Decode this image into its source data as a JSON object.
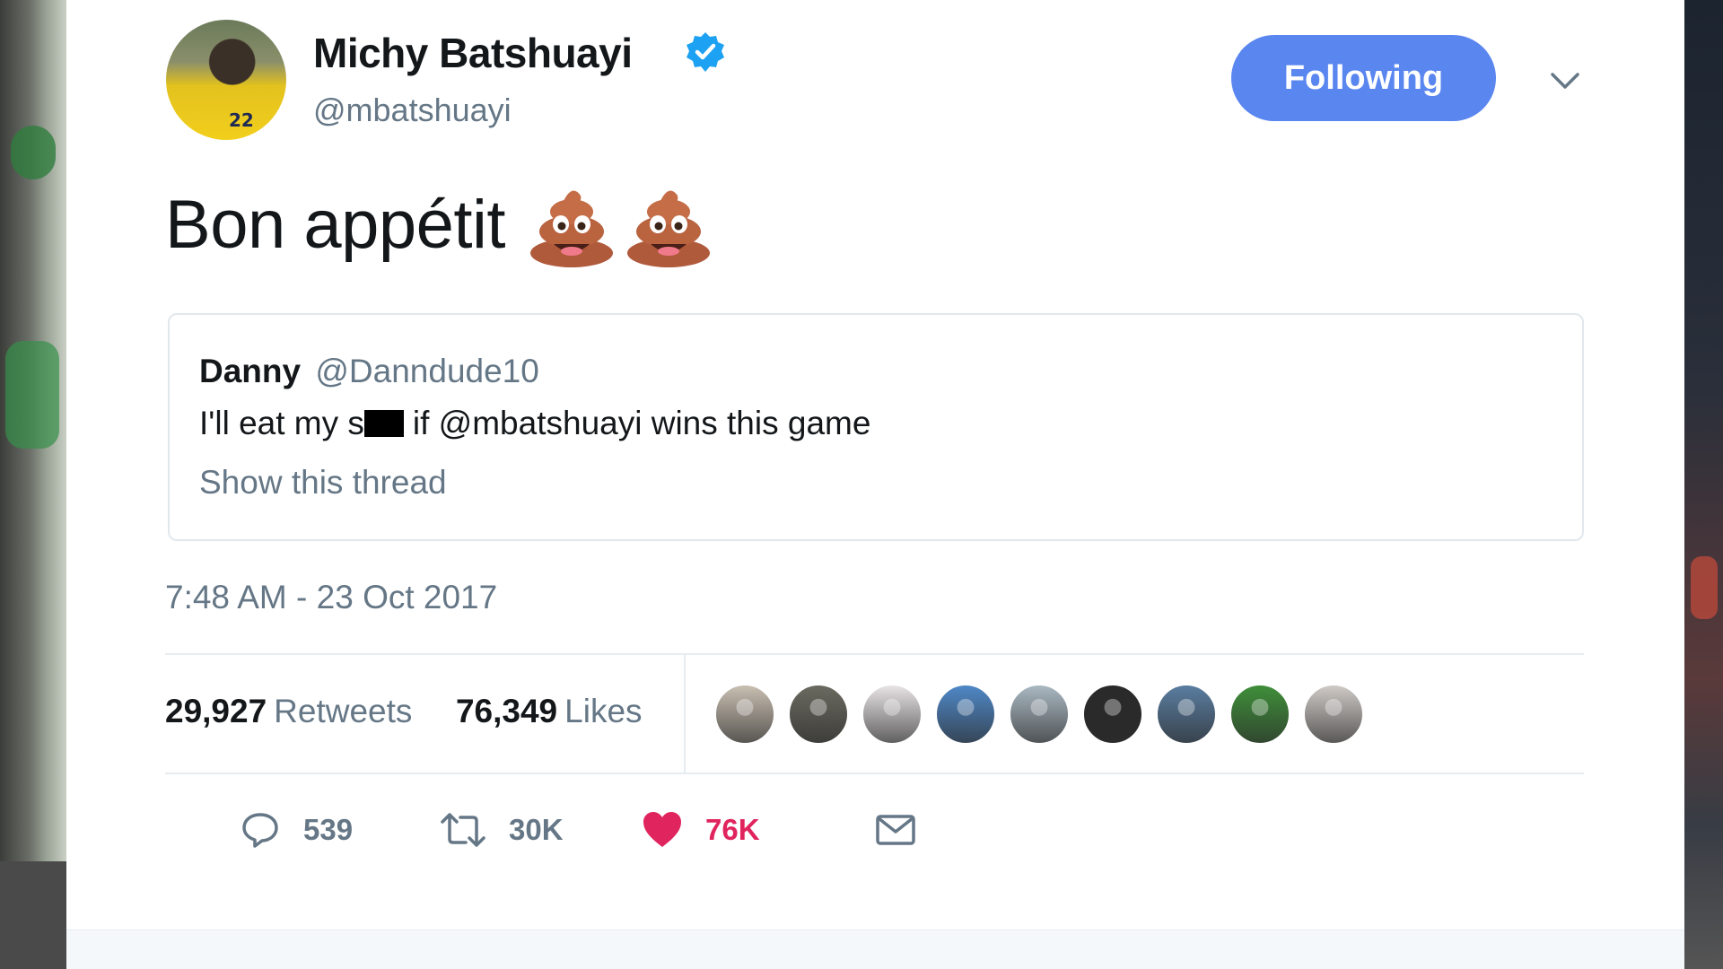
{
  "user": {
    "display_name": "Michy Batshuayi",
    "handle": "@mbatshuayi",
    "verified": true,
    "avatar_jersey_number": "22"
  },
  "follow_button": {
    "label": "Following",
    "color": "#5a86f0"
  },
  "tweet": {
    "text": "Bon appétit",
    "emoji": [
      "poop-icon",
      "poop-icon"
    ],
    "timestamp": "7:48 AM - 23 Oct 2017"
  },
  "quoted_tweet": {
    "name": "Danny",
    "handle": "@Danndude10",
    "text_before": "I'll eat my s",
    "text_after": "if @mbatshuayi wins this game",
    "show_thread": "Show this thread"
  },
  "stats": {
    "retweets_count": "29,927",
    "retweets_label": "Retweets",
    "likes_count": "76,349",
    "likes_label": "Likes"
  },
  "likers": [
    {
      "name": "liker-1",
      "color": "#c9bfb2"
    },
    {
      "name": "liker-2",
      "color": "#6b6a60"
    },
    {
      "name": "liker-3",
      "color": "#e8e4e6"
    },
    {
      "name": "liker-4",
      "color": "#4f88c7"
    },
    {
      "name": "liker-5",
      "color": "#aab8c2"
    },
    {
      "name": "liker-6",
      "color": "#2a2a2a"
    },
    {
      "name": "liker-7",
      "color": "#5a7da0"
    },
    {
      "name": "liker-8",
      "color": "#3f8f3a"
    },
    {
      "name": "liker-9",
      "color": "#cfcac6"
    }
  ],
  "actions": {
    "reply_count": "539",
    "retweet_count": "30K",
    "like_count": "76K",
    "like_color": "#e0245e"
  }
}
